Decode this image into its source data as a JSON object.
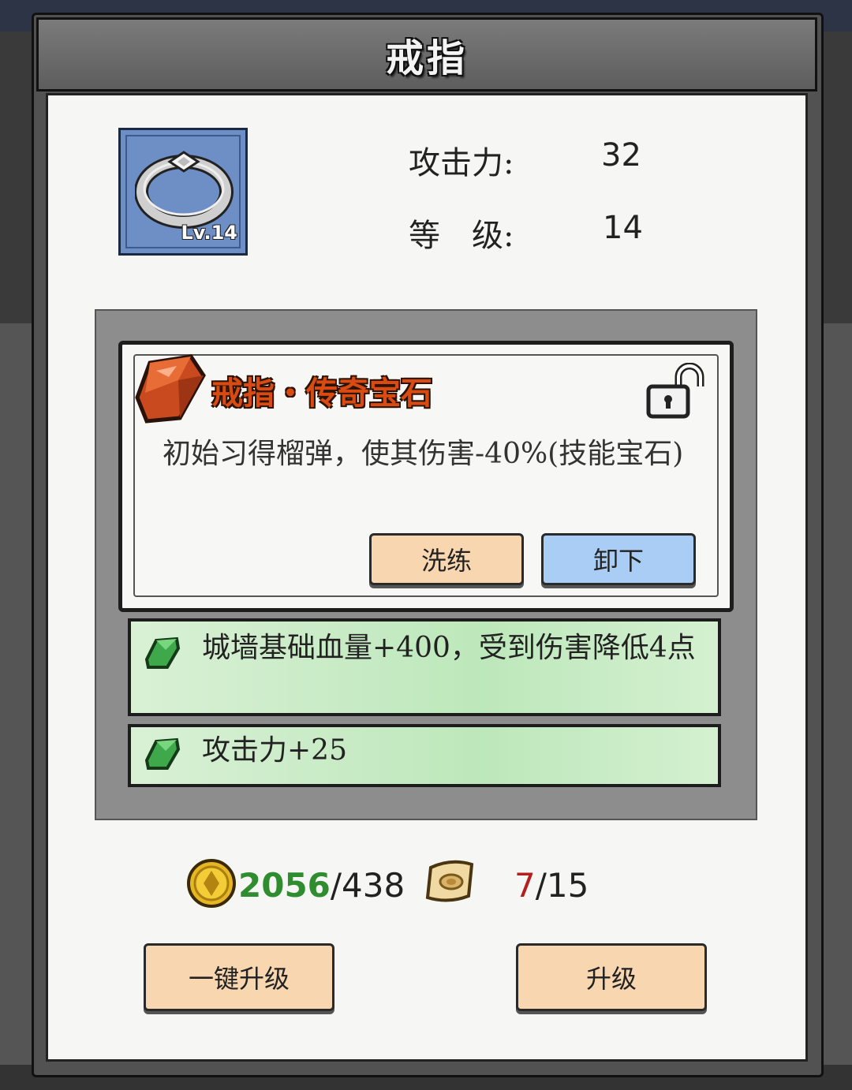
{
  "title": "戒指",
  "item": {
    "level_badge": "Lv.14"
  },
  "stats": [
    {
      "label": "攻击力:",
      "value": "32"
    },
    {
      "label": "等　级:",
      "value": "14"
    }
  ],
  "gem": {
    "name": "戒指・传奇宝石",
    "description": "初始习得榴弹，使其伤害-40%(技能宝石)",
    "lock_state": "unlocked",
    "buttons": {
      "reroll": "洗练",
      "unequip": "卸下"
    }
  },
  "bonuses": [
    {
      "text": "城墙基础血量+400，受到伤害降低4点"
    },
    {
      "text": "攻击力+25"
    }
  ],
  "resources": {
    "coins": {
      "owned": "2056",
      "cost": "/438"
    },
    "scrolls": {
      "owned": "7",
      "cost": "/15"
    }
  },
  "buttons": {
    "upgrade_all": "一键升级",
    "upgrade": "升级"
  },
  "colors": {
    "gem_name": "#d94b12",
    "coin_enough": "#2f8d2f",
    "scroll_insufficient": "#b31e1e"
  }
}
